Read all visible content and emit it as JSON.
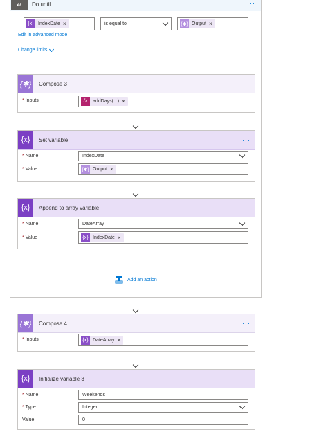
{
  "loop": {
    "title": "Do until",
    "more": "···",
    "condition": {
      "left_token": "IndexDate",
      "operator": "is equal to",
      "right_token": "Output"
    },
    "advanced_link": "Edit in advanced mode",
    "limits_link": "Change limits"
  },
  "compose3": {
    "title": "Compose 3",
    "more": "···",
    "inputs_label": "Inputs",
    "inputs_token": "addDays(...)"
  },
  "set_variable": {
    "title": "Set variable",
    "more": "···",
    "name_label": "Name",
    "name_value": "IndexDate",
    "value_label": "Value",
    "value_token": "Output"
  },
  "append_array": {
    "title": "Append to array variable",
    "more": "···",
    "name_label": "Name",
    "name_value": "DateArray",
    "value_label": "Value",
    "value_token": "IndexDate"
  },
  "add_action": {
    "label": "Add an action"
  },
  "compose4": {
    "title": "Compose 4",
    "more": "···",
    "inputs_label": "Inputs",
    "inputs_token": "DateArray"
  },
  "init_variable": {
    "title": "Initialize variable 3",
    "more": "···",
    "name_label": "Name",
    "name_value": "Weekends",
    "type_label": "Type",
    "type_value": "Integer",
    "value_label": "Value",
    "value_value": "0"
  },
  "icons": {
    "variable": "{x}",
    "compose": "{✱}",
    "expression": "fx",
    "close": "×",
    "required": "*"
  },
  "colors": {
    "accent": "#0078d4",
    "variable_purple": "#7b3fc4",
    "compose_purple": "#9a75d6",
    "expression_pink": "#b4236e"
  }
}
